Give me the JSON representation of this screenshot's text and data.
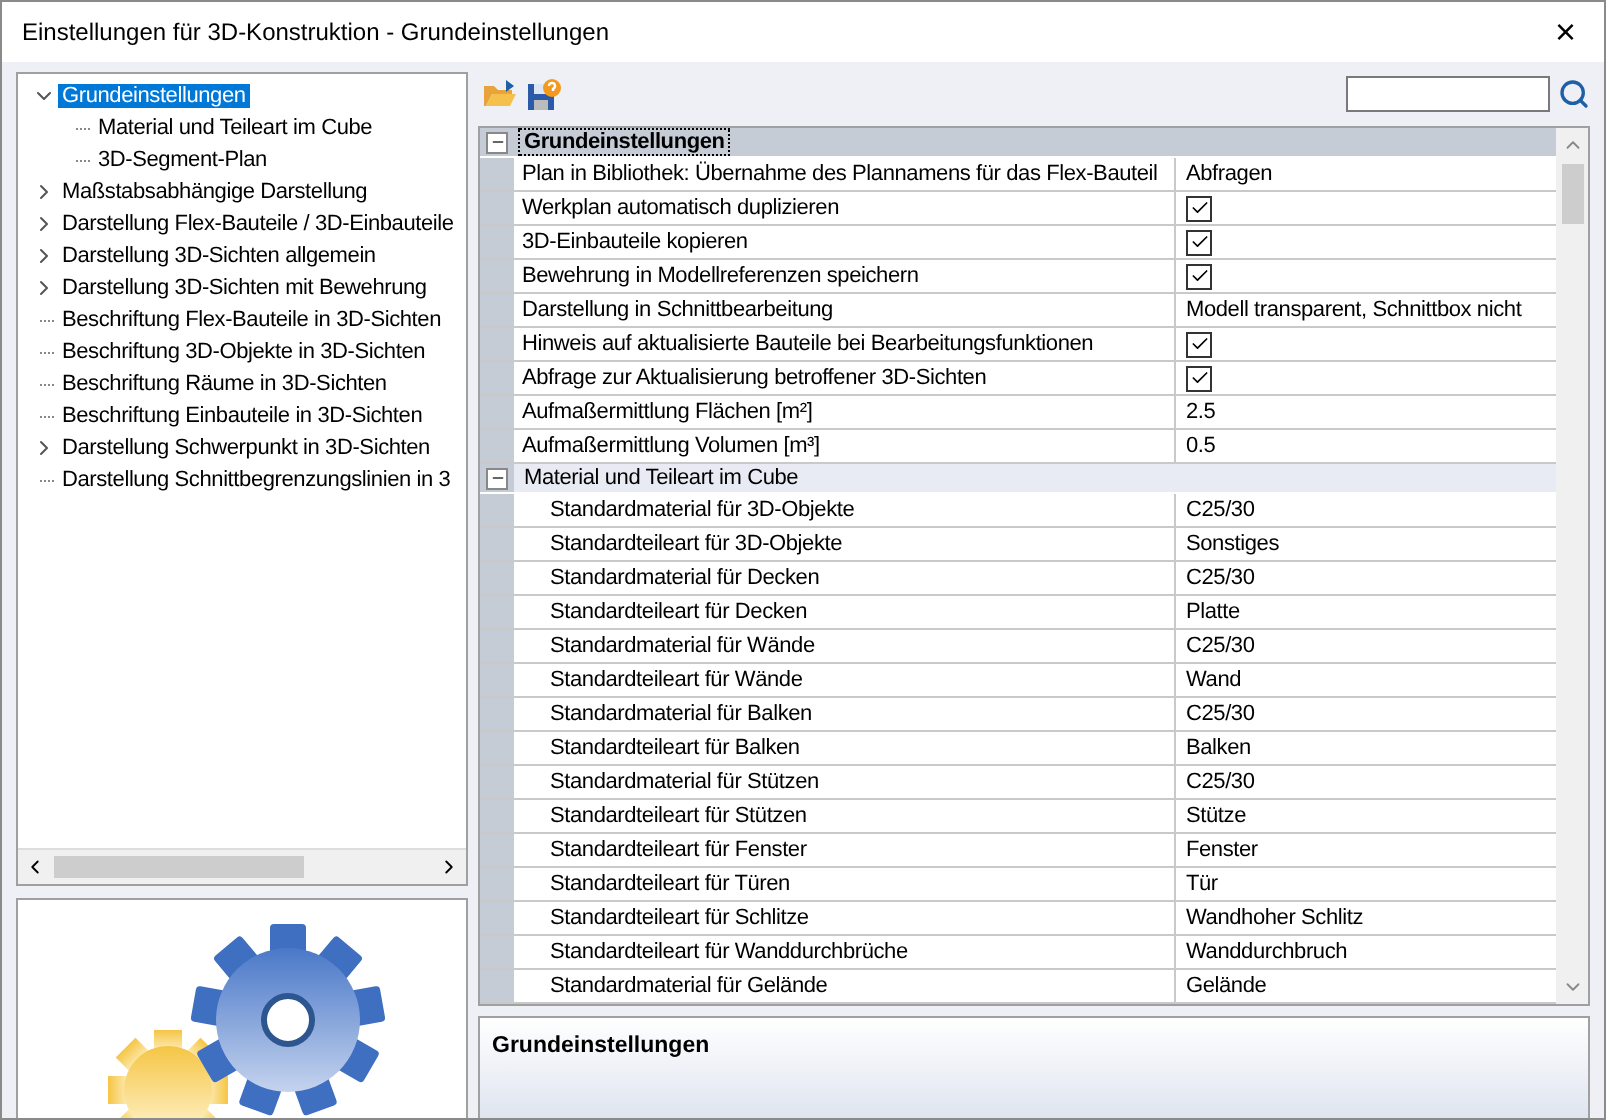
{
  "window": {
    "title": "Einstellungen für 3D-Konstruktion - Grundeinstellungen",
    "close": "×"
  },
  "tree": [
    {
      "label": "Grundeinstellungen",
      "kind": "group",
      "expanded": true,
      "selected": true,
      "children": [
        {
          "label": "Material und Teileart im Cube",
          "kind": "leaf",
          "selected": false
        },
        {
          "label": "3D-Segment-Plan",
          "kind": "leaf",
          "selected": false
        }
      ]
    },
    {
      "label": "Maßstabsabhängige Darstellung",
      "kind": "group",
      "expanded": false,
      "selected": false
    },
    {
      "label": "Darstellung Flex-Bauteile / 3D-Einbauteile",
      "kind": "group",
      "expanded": false,
      "selected": false
    },
    {
      "label": "Darstellung 3D-Sichten allgemein",
      "kind": "group",
      "expanded": false,
      "selected": false
    },
    {
      "label": "Darstellung 3D-Sichten mit Bewehrung",
      "kind": "group",
      "expanded": false,
      "selected": false
    },
    {
      "label": "Beschriftung Flex-Bauteile in 3D-Sichten",
      "kind": "leaf",
      "selected": false
    },
    {
      "label": "Beschriftung 3D-Objekte in 3D-Sichten",
      "kind": "leaf",
      "selected": false
    },
    {
      "label": "Beschriftung Räume in 3D-Sichten",
      "kind": "leaf",
      "selected": false
    },
    {
      "label": "Beschriftung Einbauteile in 3D-Sichten",
      "kind": "leaf",
      "selected": false
    },
    {
      "label": "Darstellung Schwerpunkt in 3D-Sichten",
      "kind": "group",
      "expanded": false,
      "selected": false
    },
    {
      "label": "Darstellung Schnittbegrenzungslinien in 3",
      "kind": "leaf",
      "selected": false
    }
  ],
  "property_groups": [
    {
      "title": "Grundeinstellungen",
      "expanded": true,
      "selected": true,
      "rows": [
        {
          "name": "Plan in Bibliothek: Übernahme des Plannamens für das Flex-Bauteil",
          "kind": "text",
          "value": "Abfragen"
        },
        {
          "name": "Werkplan automatisch duplizieren",
          "kind": "checkbox",
          "checked": true
        },
        {
          "name": "3D-Einbauteile kopieren",
          "kind": "checkbox",
          "checked": true
        },
        {
          "name": "Bewehrung in Modellreferenzen speichern",
          "kind": "checkbox",
          "checked": true
        },
        {
          "name": "Darstellung in Schnittbearbeitung",
          "kind": "text",
          "value": "Modell transparent, Schnittbox nicht"
        },
        {
          "name": "Hinweis auf aktualisierte Bauteile bei Bearbeitungsfunktionen",
          "kind": "checkbox",
          "checked": true
        },
        {
          "name": "Abfrage zur Aktualisierung betroffener 3D-Sichten",
          "kind": "checkbox",
          "checked": true
        },
        {
          "name": "Aufmaßermittlung Flächen [m²]",
          "kind": "text",
          "value": "2.5"
        },
        {
          "name": "Aufmaßermittlung Volumen [m³]",
          "kind": "text",
          "value": "0.5"
        }
      ]
    },
    {
      "title": "Material und Teileart im Cube",
      "expanded": true,
      "selected": false,
      "rows": [
        {
          "name": "Standardmaterial für 3D-Objekte",
          "kind": "text",
          "value": "C25/30"
        },
        {
          "name": "Standardteileart für 3D-Objekte",
          "kind": "text",
          "value": "Sonstiges"
        },
        {
          "name": "Standardmaterial für Decken",
          "kind": "text",
          "value": "C25/30"
        },
        {
          "name": "Standardteileart für Decken",
          "kind": "text",
          "value": "Platte"
        },
        {
          "name": "Standardmaterial für Wände",
          "kind": "text",
          "value": "C25/30"
        },
        {
          "name": "Standardteileart für Wände",
          "kind": "text",
          "value": "Wand"
        },
        {
          "name": "Standardmaterial für Balken",
          "kind": "text",
          "value": "C25/30"
        },
        {
          "name": "Standardteileart für Balken",
          "kind": "text",
          "value": "Balken"
        },
        {
          "name": "Standardmaterial für Stützen",
          "kind": "text",
          "value": "C25/30"
        },
        {
          "name": "Standardteileart für Stützen",
          "kind": "text",
          "value": "Stütze"
        },
        {
          "name": "Standardteileart für Fenster",
          "kind": "text",
          "value": "Fenster"
        },
        {
          "name": "Standardteileart für Türen",
          "kind": "text",
          "value": "Tür"
        },
        {
          "name": "Standardteileart für Schlitze",
          "kind": "text",
          "value": "Wandhoher Schlitz"
        },
        {
          "name": "Standardteileart für Wanddurchbrüche",
          "kind": "text",
          "value": "Wanddurchbruch"
        },
        {
          "name": "Standardmaterial für Gelände",
          "kind": "text",
          "value": "Gelände"
        }
      ]
    }
  ],
  "description": {
    "title": "Grundeinstellungen"
  }
}
